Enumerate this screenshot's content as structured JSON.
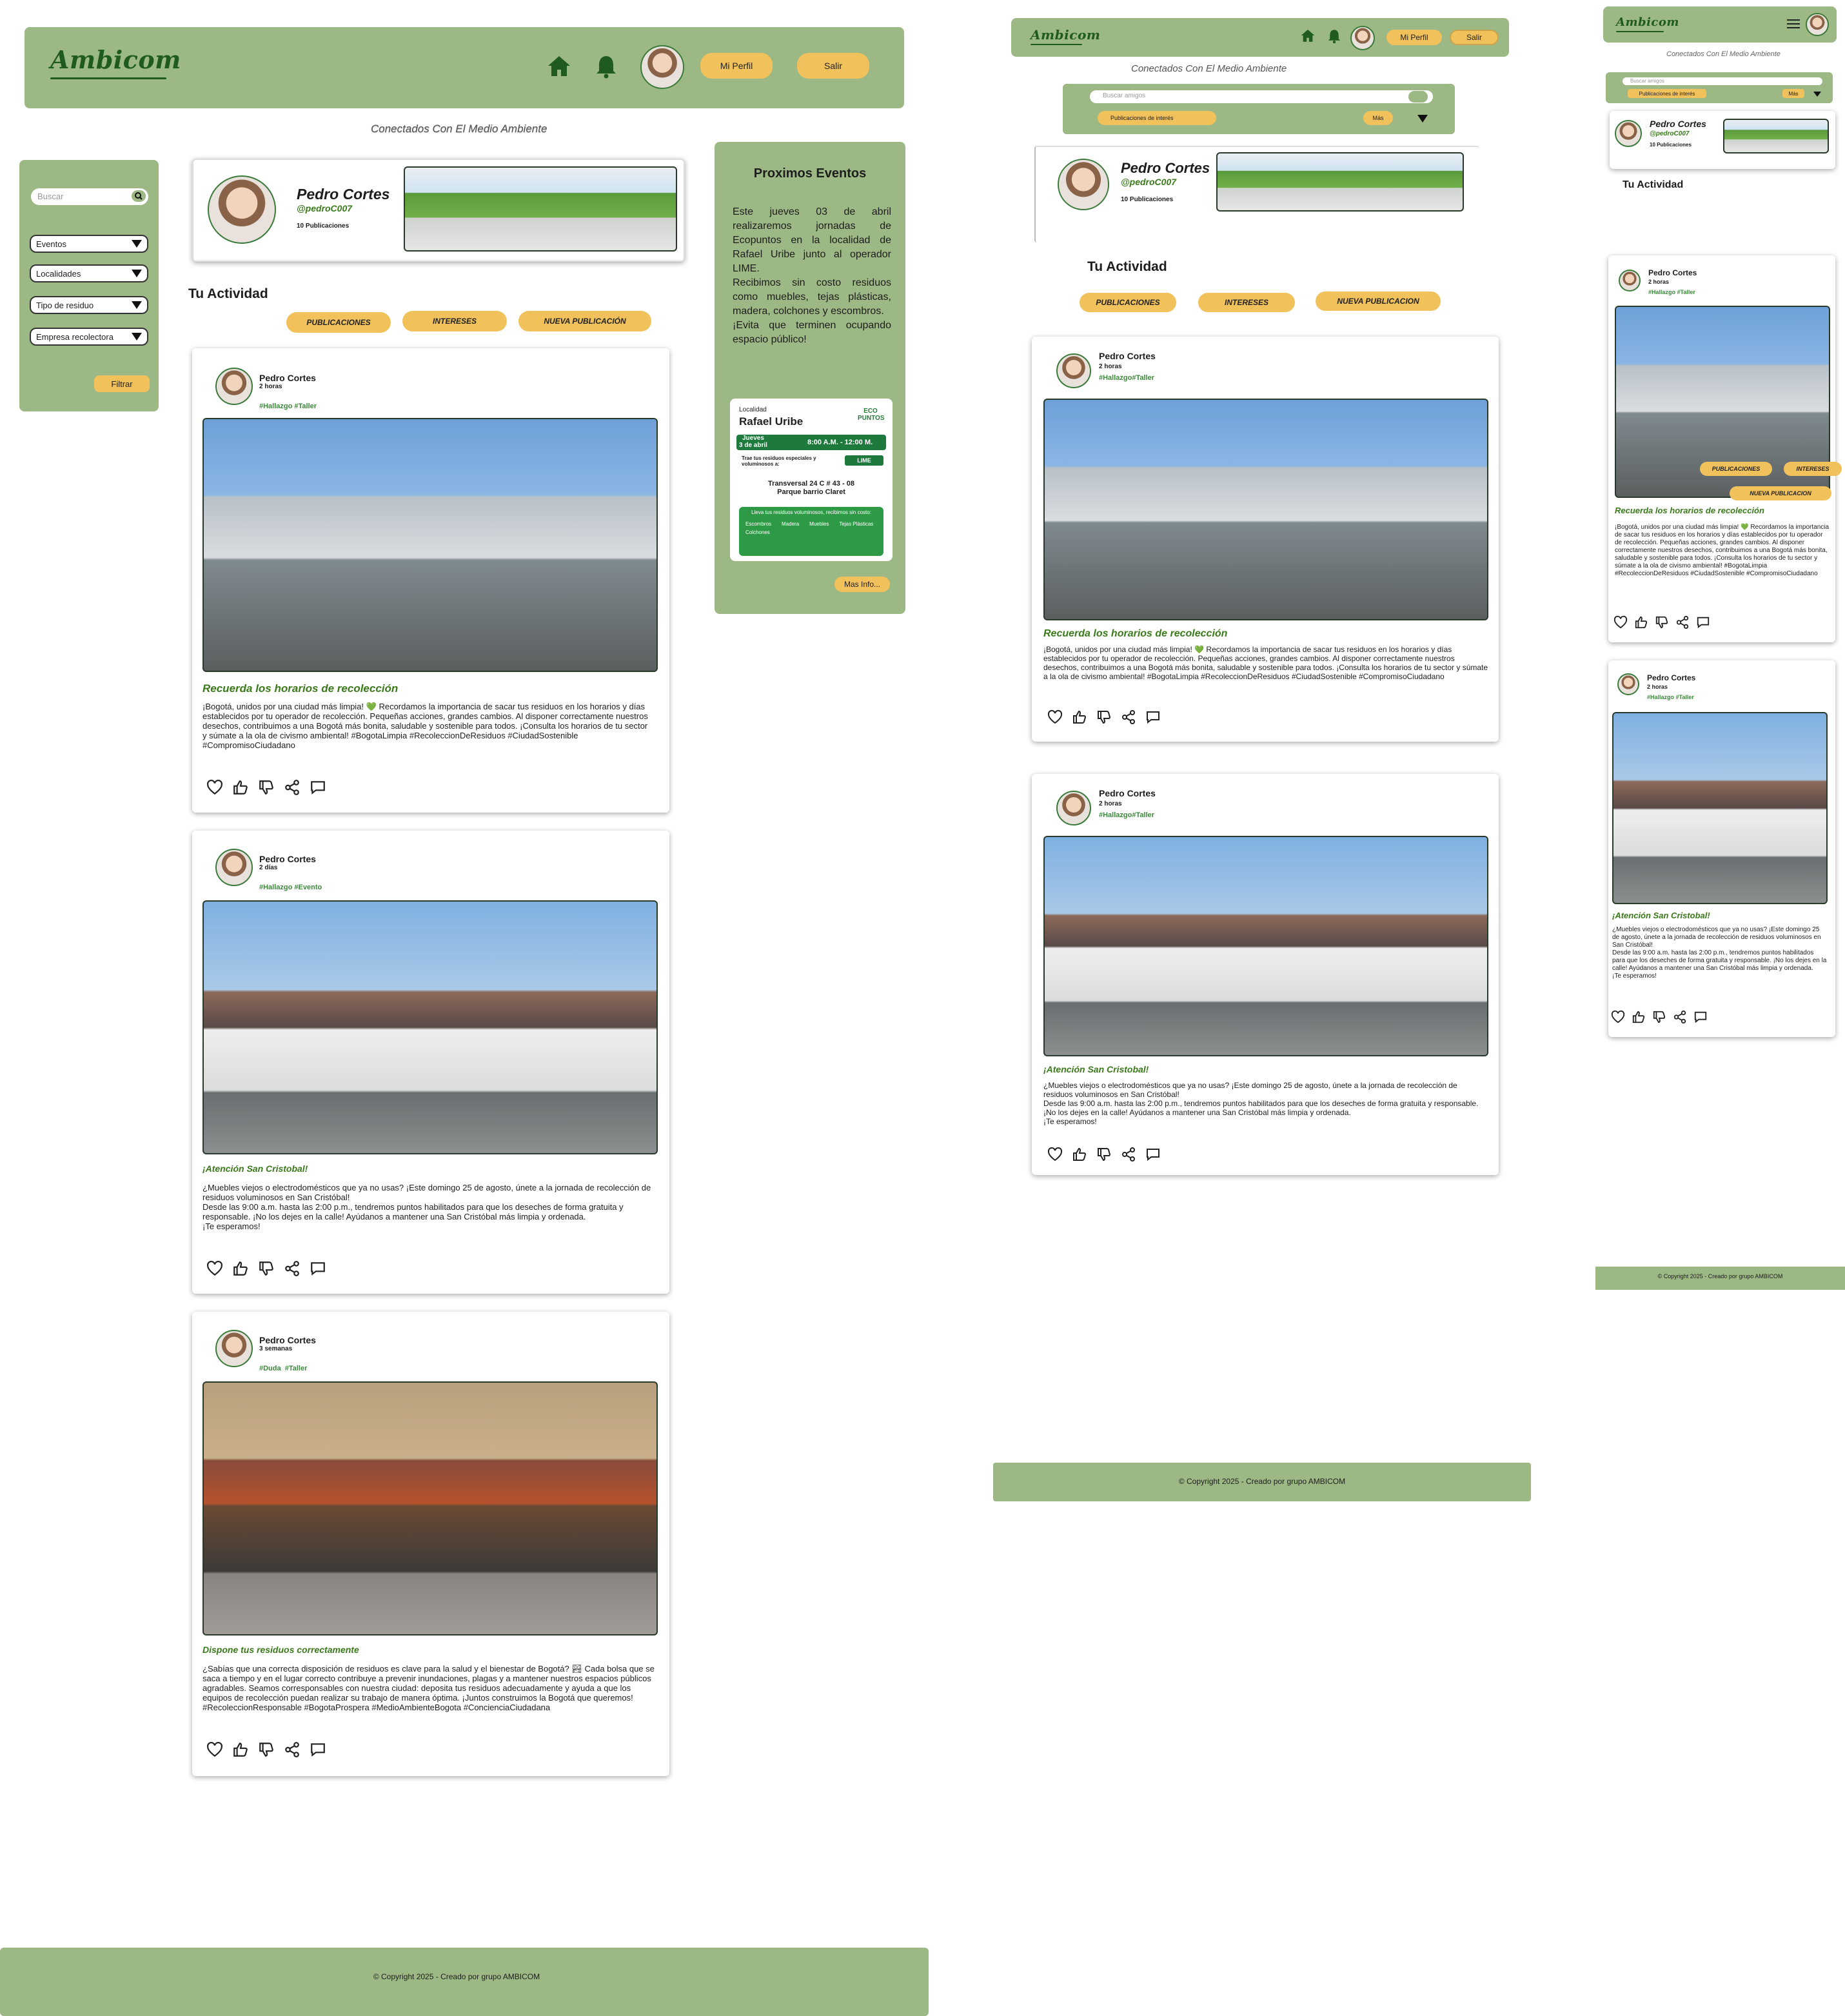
{
  "brand": {
    "logo": "Ambicom",
    "tagline": "Conectados Con El Medio Ambiente"
  },
  "nav": {
    "profile": "Mi Perfil",
    "logout": "Salir",
    "logout_small": "Salir"
  },
  "sidebar": {
    "search_placeholder": "Buscar",
    "filters": [
      "Eventos",
      "Localidades",
      "Tipo de residuo",
      "Empresa recolectora"
    ],
    "filter_button": "Filtrar"
  },
  "profile": {
    "name": "Pedro Cortes",
    "handle": "@pedroC007",
    "posts": "10 Publicaciones"
  },
  "activity": {
    "title": "Tu Actividad",
    "tabs": [
      "PUBLICACIONES",
      "INTERESES",
      "NUEVA PUBLICACIÓN"
    ],
    "tabs_tablet": [
      "PUBLICACIONES",
      "INTERESES",
      "NUEVA PUBLICACION"
    ]
  },
  "events": {
    "title": "Proximos Eventos",
    "body": "Este jueves 03 de abril realizaremos jornadas de Ecopuntos en la localidad de Rafael Uribe junto al operador LIME.\nRecibimos sin costo residuos como muebles, tejas plásticas, madera, colchones y escombros.\n¡Evita que terminen ocupando espacio público!",
    "flyer": {
      "locality_label": "Localidad",
      "locality": "Rafael Uribe",
      "brand": "ECO PUNTOS",
      "day": "Jueves",
      "date": "3 de abril",
      "hours": "8:00 A.M. - 12:00 M.",
      "note": "Trae tus residuos especiales y voluminosos a:",
      "operator": "LIME",
      "address": "Transversal 24 C # 43 - 08",
      "place": "Parque barrio Claret",
      "banner": "Lleva tus residuos voluminosos, recibimos sin costo:",
      "items": [
        "Escombros",
        "Madera",
        "Muebles",
        "Tejas Plásticas",
        "Colchones"
      ]
    },
    "more": "Mas Info..."
  },
  "posts": [
    {
      "author": "Pedro Cortes",
      "time": "2 horas",
      "tags": "#Hallazgo #Taller",
      "tags_tablet": "#Hallazgo#Taller",
      "title": "Recuerda los horarios de recolección",
      "body": "¡Bogotá, unidos por una ciudad más limpia! 💚 Recordamos la importancia de sacar tus residuos en los horarios y días establecidos por tu operador de recolección. Pequeñas acciones, grandes cambios. Al disponer correctamente nuestros desechos, contribuimos a una Bogotá más bonita, saludable y sostenible para todos. ¡Consulta los horarios de tu sector y súmate a la ola de civismo ambiental! #BogotaLimpia #RecoleccionDeResiduos #CiudadSostenible #CompromisoCiudadano"
    },
    {
      "author": "Pedro Cortes",
      "time": "2 días",
      "tags": "#Hallazgo #Evento",
      "tags_tablet": "#Hallazgo #Taller",
      "title": "¡Atención San Cristobal!",
      "body": "¿Muebles viejos o electrodomésticos que ya no usas? ¡Este domingo 25 de agosto, únete a la jornada de recolección de residuos voluminosos en San Cristóbal!\nDesde las 9:00 a.m. hasta las 2:00 p.m., tendremos puntos habilitados para que los deseches de forma gratuita y responsable. ¡No los dejes en la calle! Ayúdanos a mantener una San Cristóbal más limpia y ordenada.\n¡Te esperamos!"
    },
    {
      "author": "Pedro Cortes",
      "time": "3 semanas",
      "tags": "#Duda  #Taller",
      "title": "Dispone tus residuos correctamente",
      "body": "¿Sabías que una correcta disposición de residuos es clave para la salud y el bienestar de Bogotá? 🏞 Cada bolsa que se saca a tiempo y en el lugar correcto contribuye a prevenir inundaciones, plagas y a mantener nuestros espacios públicos agradables. Seamos corresponsables con nuestra ciudad: deposita tus residuos adecuadamente y ayuda a que los equipos de recolección puedan realizar su trabajo de manera óptima. ¡Juntos construimos la Bogotá que queremos! #RecoleccionResponsable #BogotaProspera #MedioAmbienteBogota #ConcienciaCiudadana"
    }
  ],
  "tablet": {
    "search_placeholder": "Buscar amigos",
    "interests": "Publicaciones de interés",
    "more": "Más"
  },
  "mobile": {
    "search_placeholder": "Buscar amigos",
    "interests": "Publicaciones de interés",
    "more": "Más"
  },
  "footer": {
    "copyright": "© Copyright 2025 - Creado por grupo AMBICOM"
  },
  "colors": {
    "brand_green": "#9cb884",
    "accent_yellow": "#f1c15c",
    "text_green": "#3a7a1a"
  }
}
